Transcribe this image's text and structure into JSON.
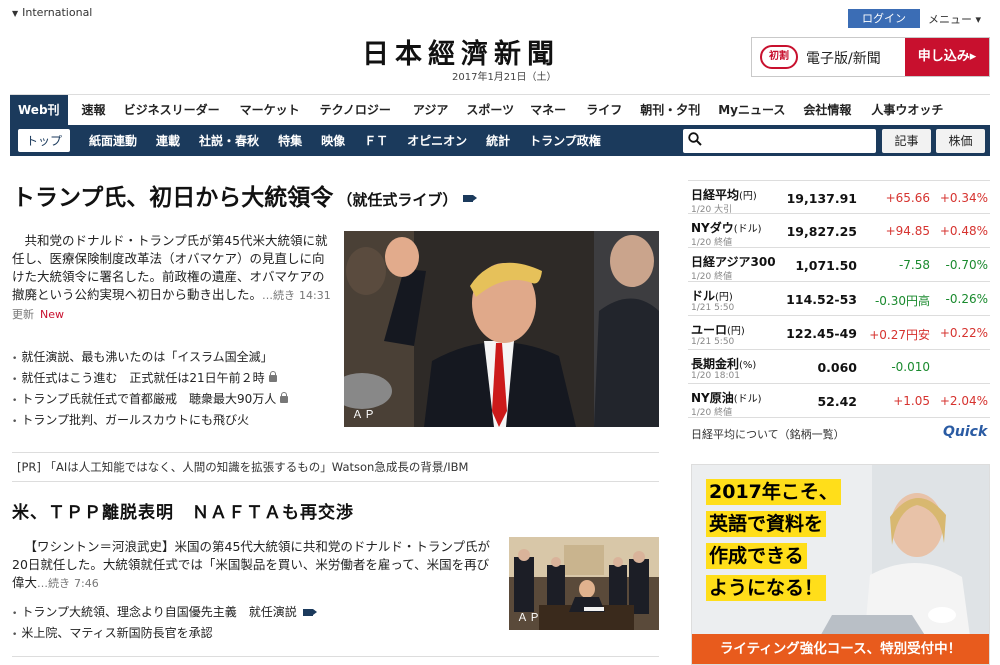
{
  "header": {
    "region": "International",
    "logo": "日本經濟新聞",
    "date": "2017年1月21日（土）",
    "login": "ログイン",
    "menu": "メニュー ▾",
    "promo": {
      "badge": "初割",
      "text": "電子版/新聞",
      "button": "申し込み▸"
    }
  },
  "nav_main": [
    "Web刊",
    "速報",
    "ビジネスリーダー",
    "マーケット",
    "テクノロジー",
    "アジア",
    "スポーツ",
    "マネー",
    "ライフ",
    "朝刊・夕刊",
    "Myニュース",
    "会社情報",
    "人事ウオッチ"
  ],
  "nav_sub": [
    "トップ",
    "紙面連動",
    "連載",
    "社説・春秋",
    "特集",
    "映像",
    "ＦＴ",
    "オピニオン",
    "統計",
    "トランプ政権"
  ],
  "search": {
    "placeholder": "",
    "btn_article": "記事",
    "btn_stock": "株価"
  },
  "top_story": {
    "headline": "トランプ氏、初日から大統領令",
    "sub": "（就任式ライブ）",
    "lead": "共和党のドナルド・トランプ氏が第45代米大統領に就任し、医療保険制度改革法（オバマケア）の見直しに向けた大統領令に署名した。前政権の遺産、オバマケアの撤廃という公約実現へ初日から動き出した。",
    "more": "…続き",
    "time": "14:31更新",
    "new_label": "New",
    "photo_credit": "ＡＰ",
    "links": [
      "就任演説、最も沸いたのは「イスラム国全滅」",
      "就任式はこう進む　正式就任は21日午前２時",
      "トランプ氏就任式で首都厳戒　聴衆最大90万人",
      "トランプ批判、ガールスカウトにも飛び火"
    ]
  },
  "pr": "[PR] 「AIは人工知能ではなく、人間の知識を拡張するもの」Watson急成長の背景/IBM",
  "second_story": {
    "headline": "米、ＴＰＰ離脱表明　ＮＡＦＴＡも再交渉",
    "lead": "【ワシントン＝河浪武史】米国の第45代大統領に共和党のドナルド・トランプ氏が20日就任した。大統領就任式では「米国製品を買い、米労働者を雇って、米国を再び偉大",
    "more": "…続き",
    "time": "7:46",
    "photo_credit": "ＡＰ",
    "links": [
      "トランプ大統領、理念より自国優先主義　就任演説",
      "米上院、マティス新国防長官を承認"
    ]
  },
  "market": [
    {
      "name": "日経平均",
      "unit": "(円)",
      "date": "1/20 大引",
      "value": "19,137.91",
      "change": "+65.66",
      "pct": "+0.34%",
      "change_dir": "up",
      "pct_dir": "up"
    },
    {
      "name": "NYダウ",
      "unit": "(ドル)",
      "date": "1/20 終値",
      "value": "19,827.25",
      "change": "+94.85",
      "pct": "+0.48%",
      "change_dir": "up",
      "pct_dir": "up"
    },
    {
      "name": "日経アジア300",
      "unit": "",
      "date": "1/20 終値",
      "value": "1,071.50",
      "change": "-7.58",
      "pct": "-0.70%",
      "change_dir": "down",
      "pct_dir": "down"
    },
    {
      "name": "ドル",
      "unit": "(円)",
      "date": "1/21 5:50",
      "value": "114.52-53",
      "change": "-0.30円高",
      "pct": "-0.26%",
      "change_dir": "down",
      "pct_dir": "down"
    },
    {
      "name": "ユーロ",
      "unit": "(円)",
      "date": "1/21 5:50",
      "value": "122.45-49",
      "change": "+0.27円安",
      "pct": "+0.22%",
      "change_dir": "up",
      "pct_dir": "up"
    },
    {
      "name": "長期金利",
      "unit": "(%)",
      "date": "1/20 18:01",
      "value": "0.060",
      "change": "-0.010",
      "pct": "",
      "change_dir": "down",
      "pct_dir": "down"
    },
    {
      "name": "NY原油",
      "unit": "(ドル)",
      "date": "1/20 終値",
      "value": "52.42",
      "change": "+1.05",
      "pct": "+2.04%",
      "change_dir": "up",
      "pct_dir": "up"
    }
  ],
  "market_footer": "日経平均について（銘柄一覧）",
  "quick_logo": "Quick",
  "ad": {
    "lines": [
      "2017年こそ、",
      "英語で資料を",
      "作成できる",
      "ようになる！"
    ],
    "bar": "ライティング強化コース、特別受付中！"
  },
  "colors": {
    "navy": "#1b3a5c",
    "red": "#c8102e",
    "up": "#d6332f",
    "down": "#1a8a2e"
  }
}
